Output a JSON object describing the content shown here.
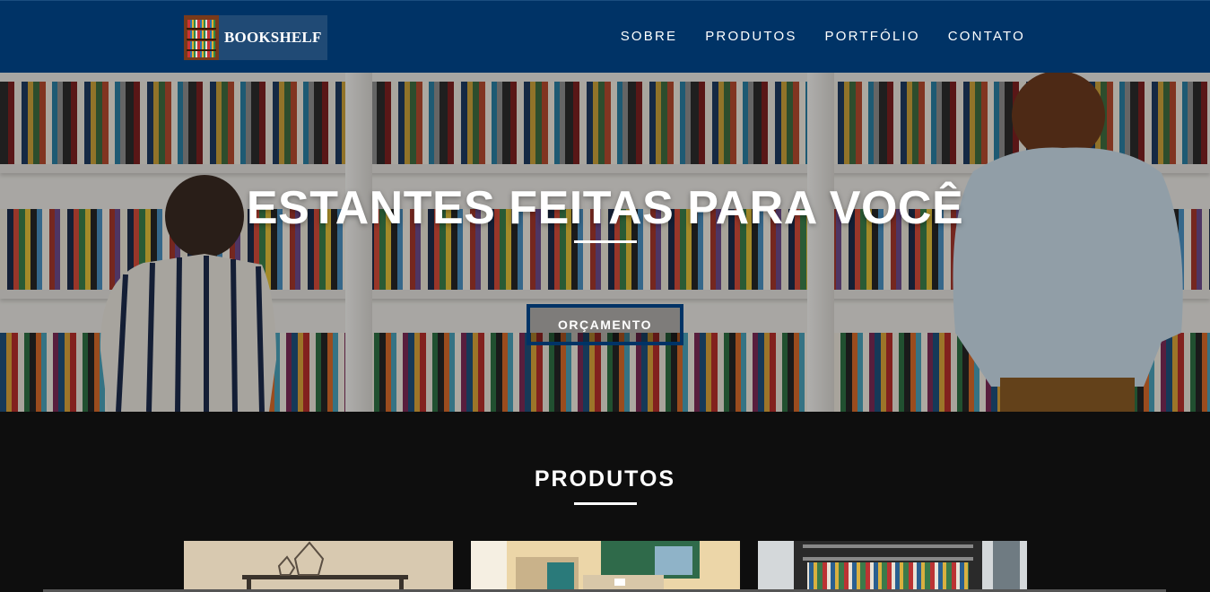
{
  "brand": {
    "name": "BOOKSHELF"
  },
  "nav": {
    "items": [
      {
        "label": "SOBRE"
      },
      {
        "label": "PRODUTOS"
      },
      {
        "label": "PORTFÓLIO"
      },
      {
        "label": "CONTATO"
      }
    ]
  },
  "hero": {
    "title": "ESTANTES FEITAS PARA VOCÊ",
    "button_label": "ORÇAMENTO"
  },
  "products": {
    "title": "PRODUTOS",
    "cards": [
      {
        "image": "bookshelf-decor-photo"
      },
      {
        "image": "kids-room-shelf-photo"
      },
      {
        "image": "dark-bookshelf-photo"
      }
    ]
  },
  "colors": {
    "navbar": "#003366",
    "page": "#0e0e0e",
    "accent": "#ffffff"
  }
}
